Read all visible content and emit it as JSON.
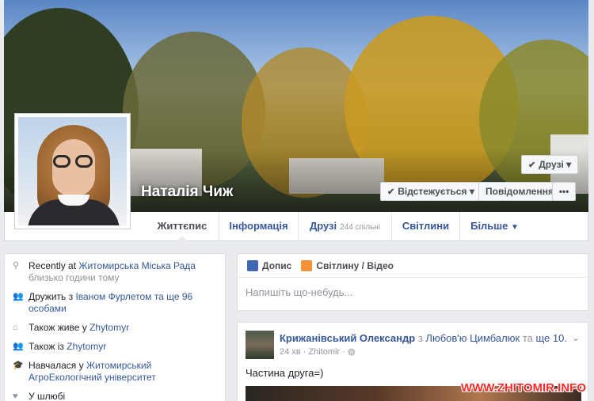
{
  "profile": {
    "name": "Наталія Чиж",
    "buttons": {
      "friends": "Друзі",
      "following": "Відстежується",
      "message": "Повідомлення",
      "more": "•••"
    }
  },
  "tabs": [
    {
      "label": "Життєпис"
    },
    {
      "label": "Інформація"
    },
    {
      "label": "Друзі",
      "count": "244 спільні"
    },
    {
      "label": "Світлини"
    },
    {
      "label": "Більше"
    }
  ],
  "intro": {
    "recently_prefix": "Recently at",
    "recently_place": "Житомирська Міська Рада",
    "recently_time": "близько години тому",
    "married_prefix": "Дружить з",
    "married_name": "Іваном Фурлетом",
    "married_suffix": "та ще 96 особами",
    "lives_prefix": "Також живе у",
    "lives_place": "Zhytomyr",
    "from_prefix": "Також із",
    "from_place": "Zhytomyr",
    "studied_prefix": "Навчалася у",
    "studied_place": "Житомирський АгроЕкологічний університет",
    "relationship": "У шлюбі"
  },
  "composer": {
    "status": "Допис",
    "photo": "Світлину / Відео",
    "placeholder": "Напишіть що-небудь..."
  },
  "post": {
    "author": "Крижанівський Олександр",
    "with": "з",
    "tagged": "Любов'ю Цимбалюк",
    "and_more": "та ще 10.",
    "time": "24 хв",
    "place": "Zhitomir",
    "text": "Частина друга=)"
  },
  "watermark": "WWW.ZHITOMIR.INFO"
}
